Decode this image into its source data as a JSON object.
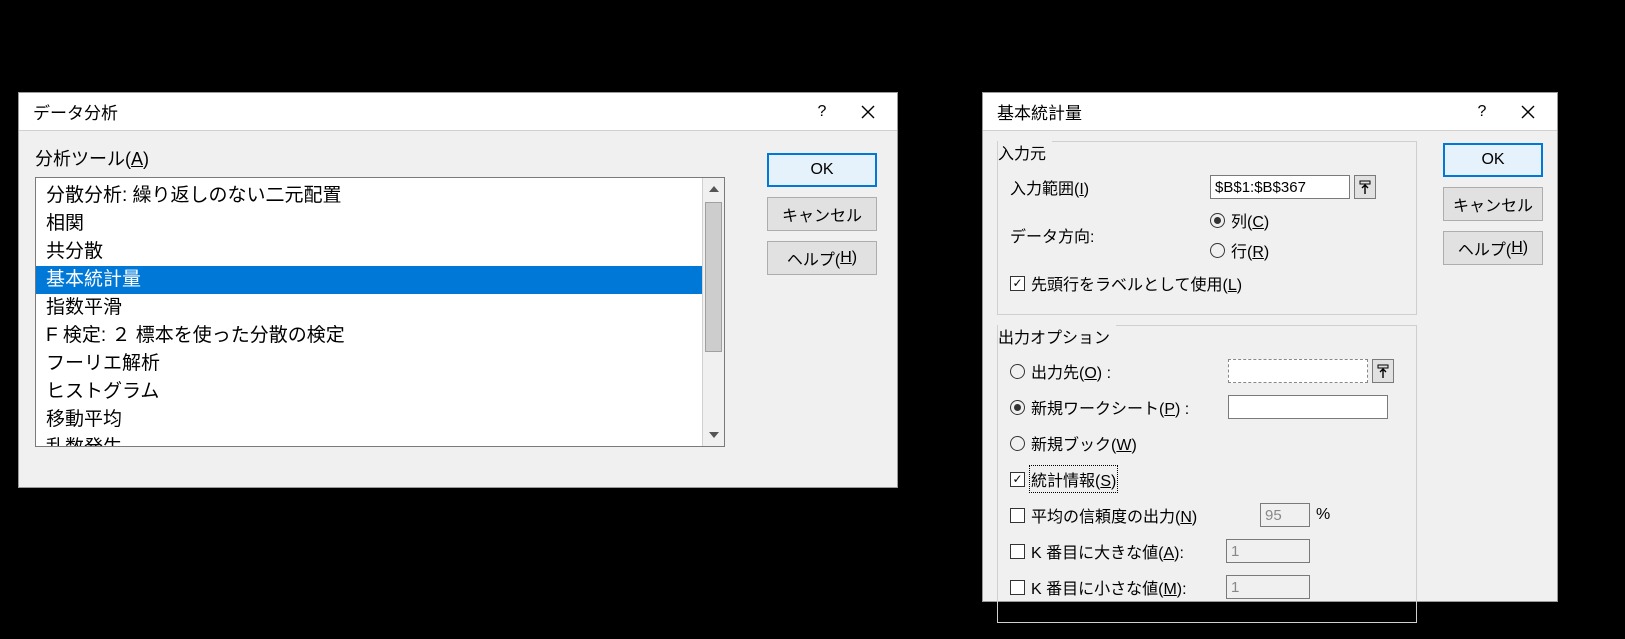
{
  "dlg1": {
    "title": "データ分析",
    "help_symbol": "?",
    "section_label_pre": "分析ツール(",
    "section_label_mn": "A",
    "section_label_post": ")",
    "items": [
      "分散分析: 繰り返しのない二元配置",
      "相関",
      "共分散",
      "基本統計量",
      "指数平滑",
      "F 検定:  ２ 標本を使った分散の検定",
      "フーリエ解析",
      "ヒストグラム",
      "移動平均",
      "乱数発生"
    ],
    "selected_index": 3,
    "buttons": {
      "ok": "OK",
      "cancel": "キャンセル",
      "help_pre": "ヘルプ(",
      "help_mn": "H",
      "help_post": ")"
    }
  },
  "dlg2": {
    "title": "基本統計量",
    "help_symbol": "?",
    "buttons": {
      "ok": "OK",
      "cancel": "キャンセル",
      "help_pre": "ヘルプ(",
      "help_mn": "H",
      "help_post": ")"
    },
    "input_group": {
      "legend": "入力元",
      "range_label_pre": "入力範囲(",
      "range_label_mn": "I",
      "range_label_post": ")",
      "range_value": "$B$1:$B$367",
      "direction_label": "データ方向:",
      "col_pre": "列(",
      "col_mn": "C",
      "col_post": ")",
      "row_pre": "行(",
      "row_mn": "R",
      "row_post": ")",
      "labels_pre": "先頭行をラベルとして使用(",
      "labels_mn": "L",
      "labels_post": ")"
    },
    "output_group": {
      "legend": "出力オプション",
      "out_range_pre": "出力先(",
      "out_range_mn": "O",
      "out_range_post": ") :",
      "new_sheet_pre": "新規ワークシート(",
      "new_sheet_mn": "P",
      "new_sheet_post": ") :",
      "new_book_pre": "新規ブック(",
      "new_book_mn": "W",
      "new_book_post": ")",
      "summary_pre": "統計情報(",
      "summary_mn": "S",
      "summary_post": ")",
      "conf_pre": "平均の信頼度の出力(",
      "conf_mn": "N",
      "conf_post": ")",
      "conf_value": "95",
      "conf_unit": "%",
      "kth_large_pre": "K 番目に大きな値(",
      "kth_large_mn": "A",
      "kth_large_post": "):",
      "kth_large_value": "1",
      "kth_small_pre": "K 番目に小さな値(",
      "kth_small_mn": "M",
      "kth_small_post": "):",
      "kth_small_value": "1"
    }
  }
}
